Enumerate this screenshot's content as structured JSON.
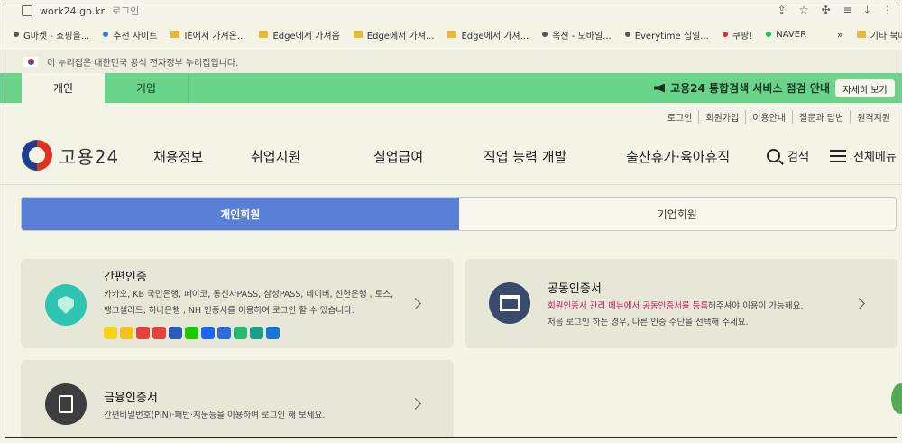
{
  "browser": {
    "url": "work24.go.kr",
    "tab_title": "로그인",
    "bookmarks": [
      {
        "label": "G마켓 - 쇼핑을...",
        "kind": "dot",
        "color": "#555555"
      },
      {
        "label": "추천 사이트",
        "kind": "dot",
        "color": "#2e7dd1"
      },
      {
        "label": "IE에서 가져온...",
        "kind": "folder"
      },
      {
        "label": "Edge에서 가져옴",
        "kind": "folder"
      },
      {
        "label": "Edge에서 가져...",
        "kind": "folder"
      },
      {
        "label": "Edge에서 가져...",
        "kind": "folder"
      },
      {
        "label": "옥션 - 모바일...",
        "kind": "dot",
        "color": "#555555"
      },
      {
        "label": "Everytime 십일...",
        "kind": "dot",
        "color": "#555555"
      },
      {
        "label": "쿠팡!",
        "kind": "dot",
        "color": "#d32f2f"
      },
      {
        "label": "NAVER",
        "kind": "dot",
        "color": "#20c35a"
      }
    ],
    "bookmarks_more": "»",
    "other_bookmarks": "기타 북마"
  },
  "gov_banner": "이 누리집은 대한민국 공식 전자정부 누리집입니다.",
  "topnav": {
    "tabs": [
      "개인",
      "기업"
    ],
    "notice": "고용24 통합검색 서비스 점검 안내",
    "detail_button": "자세히 보기"
  },
  "util_links": [
    "로그인",
    "회원가입",
    "이용안내",
    "질문과 답변",
    "원격지원"
  ],
  "logo_text": "고용24",
  "mainnav": [
    "채용정보",
    "취업지원",
    "실업급여",
    "직업 능력 개발",
    "출산휴가·육아휴직"
  ],
  "search_label": "검색",
  "allmenu_label": "전체메뉴",
  "member_tabs": [
    "개인회원",
    "기업회원"
  ],
  "cards": {
    "simple": {
      "title": "간편인증",
      "desc1": "카카오, KB 국민은행, 페이코, 통신사PASS, 삼성PASS, 네이버, 신한은행 , 토스,",
      "desc2": "뱅크샐러드, 하나은행 , NH 인증서를 이용하여 로그인 할 수 있습니다."
    },
    "joint": {
      "title": "공동인증서",
      "desc1_highlight": "회원인증서 관리 메뉴에서 공동인증서를 등록",
      "desc1_rest": "해주셔야 이용이 가능해요.",
      "desc2": "처음 로그인 하는 경우, 다른 인증 수단을 선택해 주세요."
    },
    "finance": {
      "title": "금융인증서",
      "desc1": "간편비밀번호(PIN)·패턴·지문등을 이용하여 로그인 해 보세요."
    }
  },
  "provider_logo_colors": [
    "#f7d21a",
    "#f2c21a",
    "#e2433b",
    "#e2433b",
    "#2b5cb8",
    "#1ec800",
    "#1c64f2",
    "#2f6bd6",
    "#2bb673",
    "#1a9f8c",
    "#1976d2"
  ],
  "colors": {
    "accent_green": "#6ad58a",
    "tab_blue": "#5a7fd6",
    "highlight": "#c2185b"
  }
}
